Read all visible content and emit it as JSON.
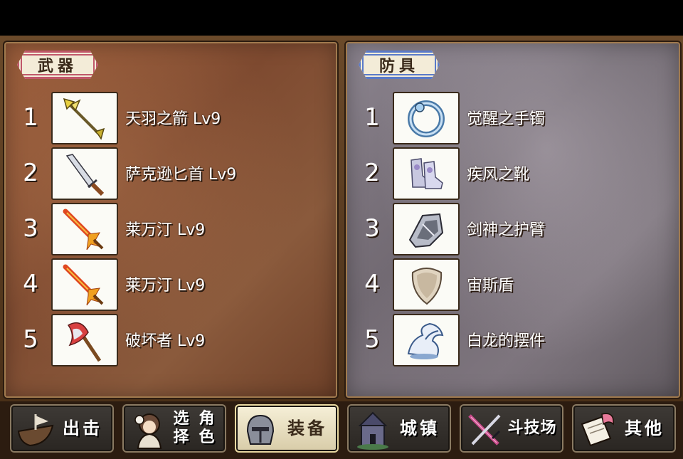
{
  "weapons": {
    "title": "武器",
    "items": [
      {
        "index": "1",
        "name": "天羽之箭 Lv9",
        "icon": "arrow-icon"
      },
      {
        "index": "2",
        "name": "萨克逊匕首 Lv9",
        "icon": "dagger-icon"
      },
      {
        "index": "3",
        "name": "莱万汀 Lv9",
        "icon": "flame-sword-icon"
      },
      {
        "index": "4",
        "name": "莱万汀 Lv9",
        "icon": "flame-sword-icon"
      },
      {
        "index": "5",
        "name": "破坏者 Lv9",
        "icon": "axe-icon"
      }
    ]
  },
  "armor": {
    "title": "防具",
    "items": [
      {
        "index": "1",
        "name": "觉醒之手镯",
        "icon": "bracelet-icon"
      },
      {
        "index": "2",
        "name": "疾风之靴",
        "icon": "boots-icon"
      },
      {
        "index": "3",
        "name": "剑神之护臂",
        "icon": "gauntlet-icon"
      },
      {
        "index": "4",
        "name": "宙斯盾",
        "icon": "shield-icon"
      },
      {
        "index": "5",
        "name": "白龙的摆件",
        "icon": "dragon-figure-icon"
      }
    ]
  },
  "menu": {
    "sortie": "出击",
    "select_line1": "选择",
    "select_line2": "角色",
    "equip": "装备",
    "town": "城镇",
    "arena": "斗技场",
    "other": "其他",
    "active": "equip"
  },
  "colors": {
    "weapon_tag_border": "#c0586a",
    "armor_tag_border": "#5a7ac8",
    "active_button": "#f6f0d8"
  }
}
